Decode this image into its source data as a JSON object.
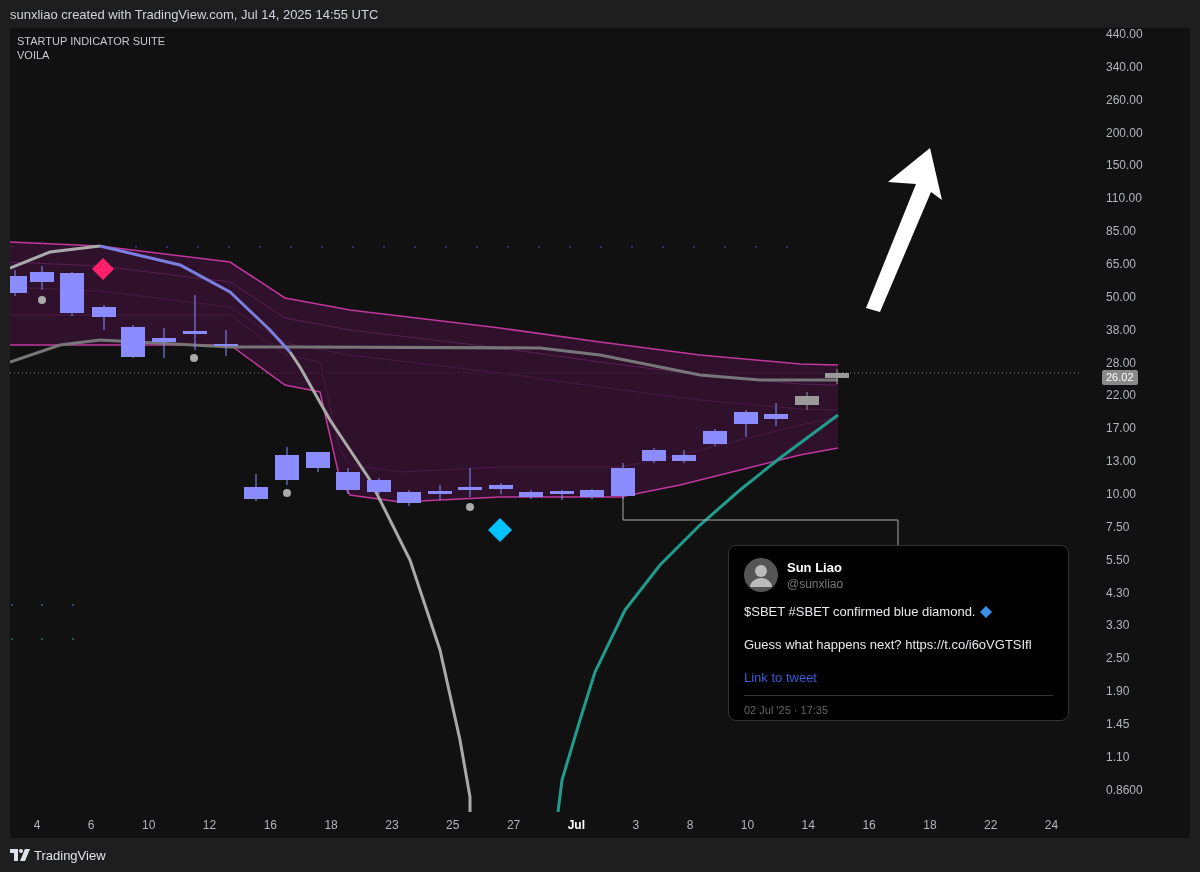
{
  "header": {
    "text": "sunxliao created with TradingView.com, Jul 14, 2025 14:55 UTC"
  },
  "chart": {
    "legend": [
      "STARTUP INDICATOR SUITE",
      "VOILA"
    ],
    "price_axis": [
      "440.00",
      "340.00",
      "260.00",
      "200.00",
      "150.00",
      "110.00",
      "85.00",
      "65.00",
      "50.00",
      "38.00",
      "28.00",
      "22.00",
      "17.00",
      "13.00",
      "10.00",
      "7.50",
      "5.50",
      "4.30",
      "3.30",
      "2.50",
      "1.90",
      "1.45",
      "1.10",
      "0.8600"
    ],
    "current_price": "26.02",
    "time_axis": [
      {
        "label": "4",
        "kind": "day"
      },
      {
        "label": "6",
        "kind": "day"
      },
      {
        "label": "10",
        "kind": "day"
      },
      {
        "label": "12",
        "kind": "day"
      },
      {
        "label": "16",
        "kind": "day"
      },
      {
        "label": "18",
        "kind": "day"
      },
      {
        "label": "23",
        "kind": "day"
      },
      {
        "label": "25",
        "kind": "day"
      },
      {
        "label": "27",
        "kind": "day"
      },
      {
        "label": "Jul",
        "kind": "month"
      },
      {
        "label": "3",
        "kind": "day"
      },
      {
        "label": "8",
        "kind": "day"
      },
      {
        "label": "10",
        "kind": "day"
      },
      {
        "label": "14",
        "kind": "day"
      },
      {
        "label": "16",
        "kind": "day"
      },
      {
        "label": "18",
        "kind": "day"
      },
      {
        "label": "22",
        "kind": "day"
      },
      {
        "label": "24",
        "kind": "day"
      }
    ]
  },
  "tweet": {
    "name": "Sun Liao",
    "handle": "@sunxliao",
    "lines": [
      "$SBET #SBET confirmed blue diamond.",
      "Guess what happens next? https://t.co/i6oVGTSIfl"
    ],
    "link": "Link to tweet",
    "date": "02 Jul '25 · 17:35"
  },
  "footer": {
    "brand": "TradingView"
  }
}
